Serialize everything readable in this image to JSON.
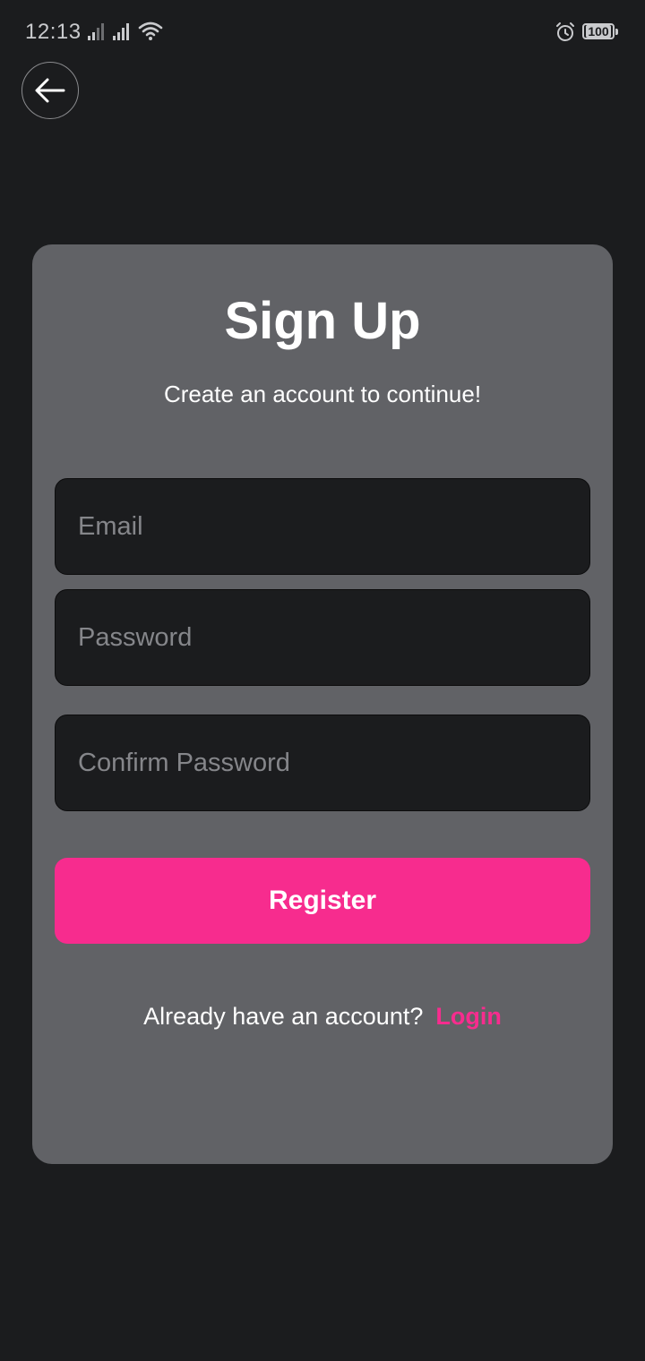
{
  "status_bar": {
    "time": "12:13",
    "battery_level": "100",
    "icons": [
      "signal-icon",
      "signal-icon",
      "wifi-icon",
      "alarm-icon",
      "battery-icon"
    ]
  },
  "nav": {
    "back_icon": "arrow-left-icon"
  },
  "card": {
    "title": "Sign Up",
    "subtitle": "Create an account to continue!"
  },
  "form": {
    "email_placeholder": "Email",
    "email_value": "",
    "password_placeholder": "Password",
    "password_value": "",
    "confirm_placeholder": "Confirm Password",
    "confirm_value": ""
  },
  "actions": {
    "register_label": "Register",
    "login_prompt": "Already have an account?",
    "login_label": "Login"
  },
  "colors": {
    "background": "#1b1c1e",
    "card": "#616266",
    "accent": "#f72c8e",
    "field": "#1b1c1e",
    "text": "#ffffff",
    "placeholder": "#85868a"
  }
}
